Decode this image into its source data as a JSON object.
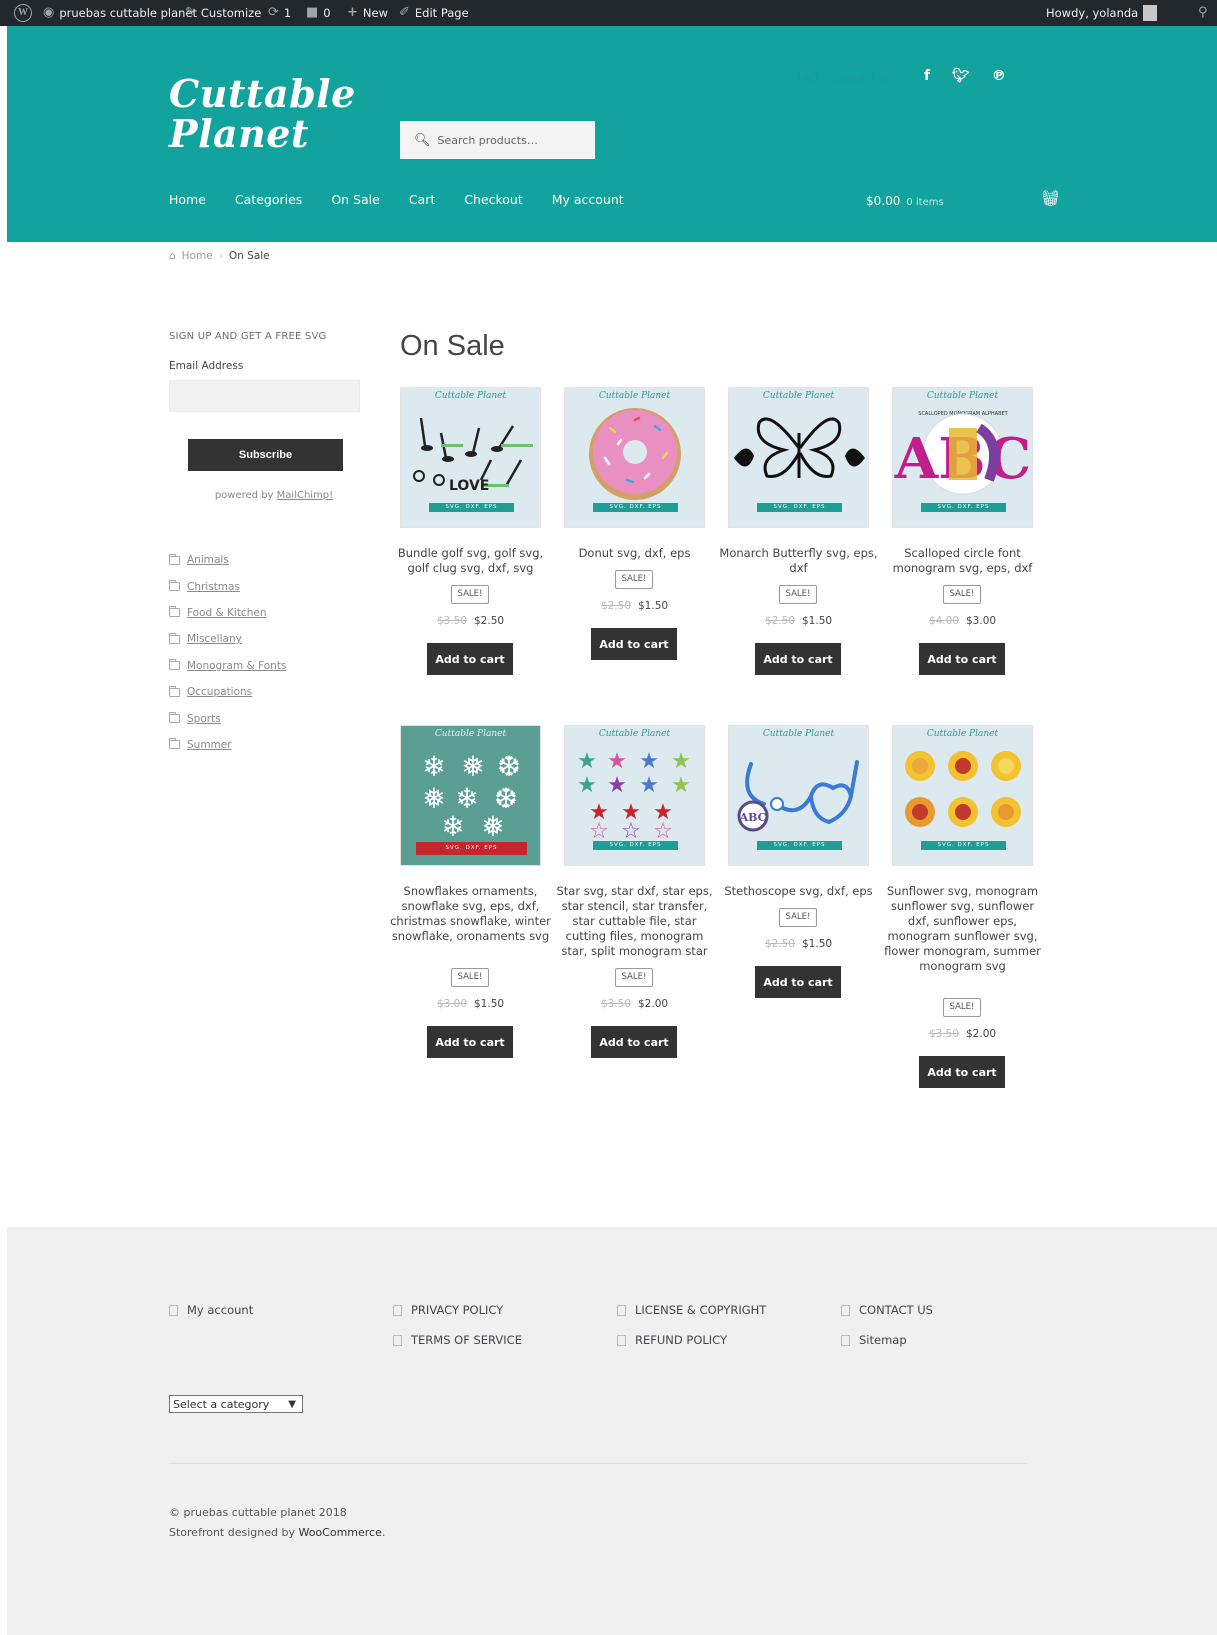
{
  "adminbar": {
    "site_name": "pruebas cuttable planet",
    "customize": "Customize",
    "updates_count": "1",
    "comments_count": "0",
    "new": "New",
    "edit_page": "Edit Page",
    "greeting": "Howdy, yolanda"
  },
  "header": {
    "logo_line1": "Cuttable",
    "logo_line2": "Planet",
    "search_placeholder": "Search products…",
    "secondary_nav": [
      "FAQ",
      "Contact us"
    ],
    "social_icons": [
      "facebook-icon",
      "twitter-icon",
      "pinterest-icon"
    ],
    "main_nav": [
      "Home",
      "Categories",
      "On Sale",
      "Cart",
      "Checkout",
      "My account"
    ],
    "cart_total": "$0.00",
    "cart_count": "0 items"
  },
  "breadcrumb": {
    "home": "Home",
    "current": "On Sale"
  },
  "sidebar": {
    "signup_title": "SIGN UP AND GET A FREE SVG",
    "email_label": "Email Address",
    "subscribe_label": "Subscribe",
    "powered_prefix": "powered by",
    "powered_link": "MailChimp!",
    "categories": [
      "Animals",
      "Christmas",
      "Food & Kitchen",
      "Miscellany",
      "Monogram & Fonts",
      "Occupations",
      "Sports",
      "Summer"
    ]
  },
  "main": {
    "title": "On Sale",
    "thumb_brand": "Cuttable Planet",
    "thumb_banner": "SVG. DXF. EPS",
    "sale_label": "SALE!",
    "add_to_cart": "Add to cart",
    "products": [
      {
        "name": "Bundle golf svg, golf svg, golf clug svg, dxf, svg",
        "old_price": "$3.50",
        "price": "$2.50"
      },
      {
        "name": "Donut svg, dxf, eps",
        "old_price": "$2.50",
        "price": "$1.50"
      },
      {
        "name": "Monarch Butterfly svg, eps, dxf",
        "old_price": "$2.50",
        "price": "$1.50"
      },
      {
        "name": "Scalloped circle font monogram svg, eps, dxf",
        "old_price": "$4.00",
        "price": "$3.00"
      },
      {
        "name": "Snowflakes ornaments, snowflake svg, eps, dxf, christmas snowflake, winter snowflake, oronaments svg",
        "old_price": "$3.00",
        "price": "$1.50"
      },
      {
        "name": "Star svg, star dxf, star eps, star stencil, star transfer, star cuttable file, star cutting files, monogram star, split monogram star",
        "old_price": "$3.50",
        "price": "$2.00"
      },
      {
        "name": "Stethoscope svg, dxf, eps",
        "old_price": "$2.50",
        "price": "$1.50"
      },
      {
        "name": "Sunflower svg, monogram sunflower svg, sunflower dxf, sunflower eps, monogram sunflower svg, flower monogram, summer monogram svg",
        "old_price": "$3.50",
        "price": "$2.00"
      }
    ],
    "thumb_texts": {
      "scalloped_header": "SCALLOPED MONOGRAM ALPHABET",
      "scalloped_letters": "ABC",
      "love": "LOVE"
    }
  },
  "footer": {
    "links": [
      "My account",
      "PRIVACY POLICY",
      "TERMS OF SERVICE",
      "LICENSE & COPYRIGHT",
      "REFUND POLICY",
      "CONTACT US",
      "Sitemap"
    ],
    "category_select": "Select a category",
    "copyright": "© pruebas cuttable planet 2018",
    "designed_prefix": "Storefront designed by",
    "designed_link": "WooCommerce",
    "designed_suffix": "."
  },
  "colors": {
    "header_bg": "#13a39e",
    "button_bg": "#333333",
    "adminbar_bg": "#23282d"
  }
}
